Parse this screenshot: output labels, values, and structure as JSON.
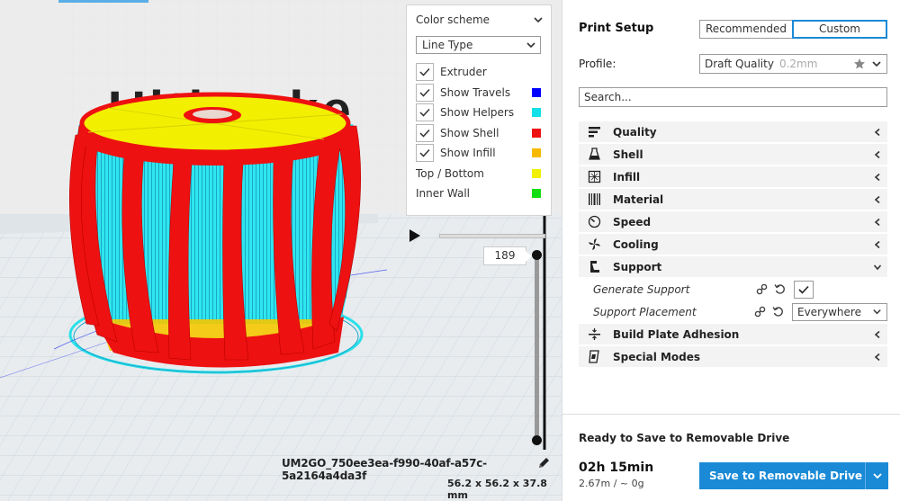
{
  "viewport": {
    "logo_text": "Ultimake",
    "color_scheme": {
      "title": "Color scheme",
      "selected": "Line Type",
      "items": [
        {
          "label": "Extruder",
          "checkbox": true,
          "checked": true,
          "color": ""
        },
        {
          "label": "Show Travels",
          "checkbox": true,
          "checked": true,
          "color": "#0000ff"
        },
        {
          "label": "Show Helpers",
          "checkbox": true,
          "checked": true,
          "color": "#11e0e8"
        },
        {
          "label": "Show Shell",
          "checkbox": true,
          "checked": true,
          "color": "#ee1111"
        },
        {
          "label": "Show Infill",
          "checkbox": true,
          "checked": true,
          "color": "#f7b900"
        },
        {
          "label": "Top / Bottom",
          "checkbox": false,
          "checked": false,
          "color": "#f0f000"
        },
        {
          "label": "Inner Wall",
          "checkbox": false,
          "checked": false,
          "color": "#11dd11"
        }
      ]
    },
    "layer_number": "189",
    "job_name": "UM2GO_750ee3ea-f990-40af-a57c-5a2164a4da3f",
    "dimensions": "56.2 x 56.2 x 37.8 mm"
  },
  "sidebar": {
    "title": "Print Setup",
    "tabs": [
      {
        "label": "Recommended",
        "active": false
      },
      {
        "label": "Custom",
        "active": true
      }
    ],
    "profile_label": "Profile:",
    "profile_name": "Draft Quality",
    "profile_sub": "0.2mm",
    "search_placeholder": "Search...",
    "categories": [
      {
        "label": "Quality",
        "icon": "quality-icon",
        "expanded": false
      },
      {
        "label": "Shell",
        "icon": "shell-icon",
        "expanded": false
      },
      {
        "label": "Infill",
        "icon": "infill-icon",
        "expanded": false
      },
      {
        "label": "Material",
        "icon": "material-icon",
        "expanded": false
      },
      {
        "label": "Speed",
        "icon": "speed-icon",
        "expanded": false
      },
      {
        "label": "Cooling",
        "icon": "cooling-icon",
        "expanded": false
      },
      {
        "label": "Support",
        "icon": "support-icon",
        "expanded": true
      },
      {
        "label": "Build Plate Adhesion",
        "icon": "adhesion-icon",
        "expanded": false
      },
      {
        "label": "Special Modes",
        "icon": "special-modes-icon",
        "expanded": false
      }
    ],
    "support_settings": {
      "generate_support_label": "Generate Support",
      "generate_support_checked": true,
      "support_placement_label": "Support Placement",
      "support_placement_value": "Everywhere"
    },
    "footer": {
      "status": "Ready to Save to Removable Drive",
      "time": "02h 15min",
      "usage": "2.67m / ~ 0g",
      "save_label": "Save to Removable Drive"
    },
    "accent_color": "#1a8ad6"
  }
}
